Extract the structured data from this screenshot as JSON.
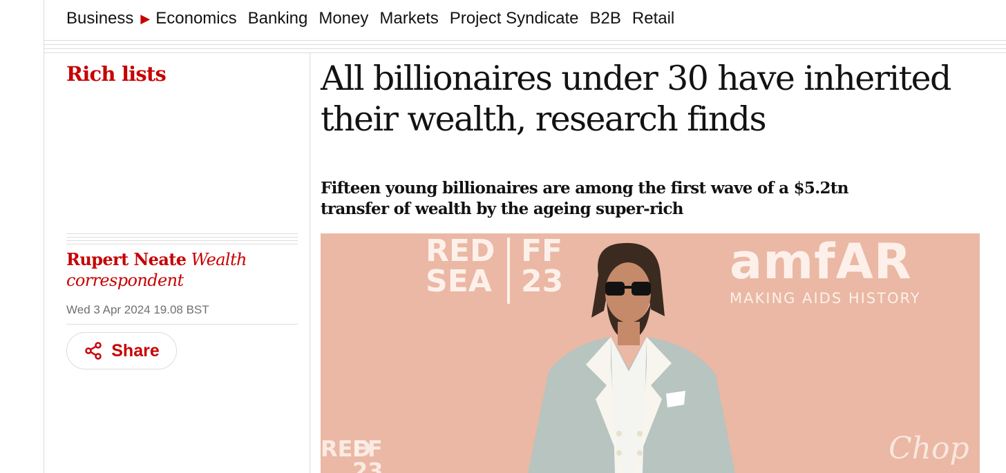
{
  "nav": {
    "items": [
      "Business",
      "Economics",
      "Banking",
      "Money",
      "Markets",
      "Project Syndicate",
      "B2B",
      "Retail"
    ],
    "arrow_icon": "triangle-right-icon"
  },
  "article": {
    "section": "Rich lists",
    "headline_line1": "All billionaires under 30 have inherited",
    "headline_line2": "their wealth, research finds",
    "standfirst_line1": "Fifteen young billionaires are among the first wave of a $5.2tn",
    "standfirst_line2": "transfer of wealth by the ageing super-rich",
    "author_name": "Rupert Neate",
    "author_role_line1": "Wealth",
    "author_role_line2": "correspondent",
    "date": "Wed 3 Apr 2024 19.08 BST",
    "share_label": "Share"
  },
  "photo": {
    "backdrop_logo_1_line1": "RED",
    "backdrop_logo_1_line2": "SEA",
    "backdrop_logo_2_line1": "FF",
    "backdrop_logo_2_line2": "23",
    "backdrop_brand": "amfAR",
    "backdrop_tagline": "MAKING AIDS HISTORY",
    "backdrop_sponsor": "Chop",
    "colors": {
      "backdrop": "#eab8a4",
      "suit": "#b7c4c0"
    }
  },
  "colors": {
    "accent": "#c70000",
    "text": "#121212",
    "muted": "#707070",
    "rule": "#dcdcdc"
  }
}
